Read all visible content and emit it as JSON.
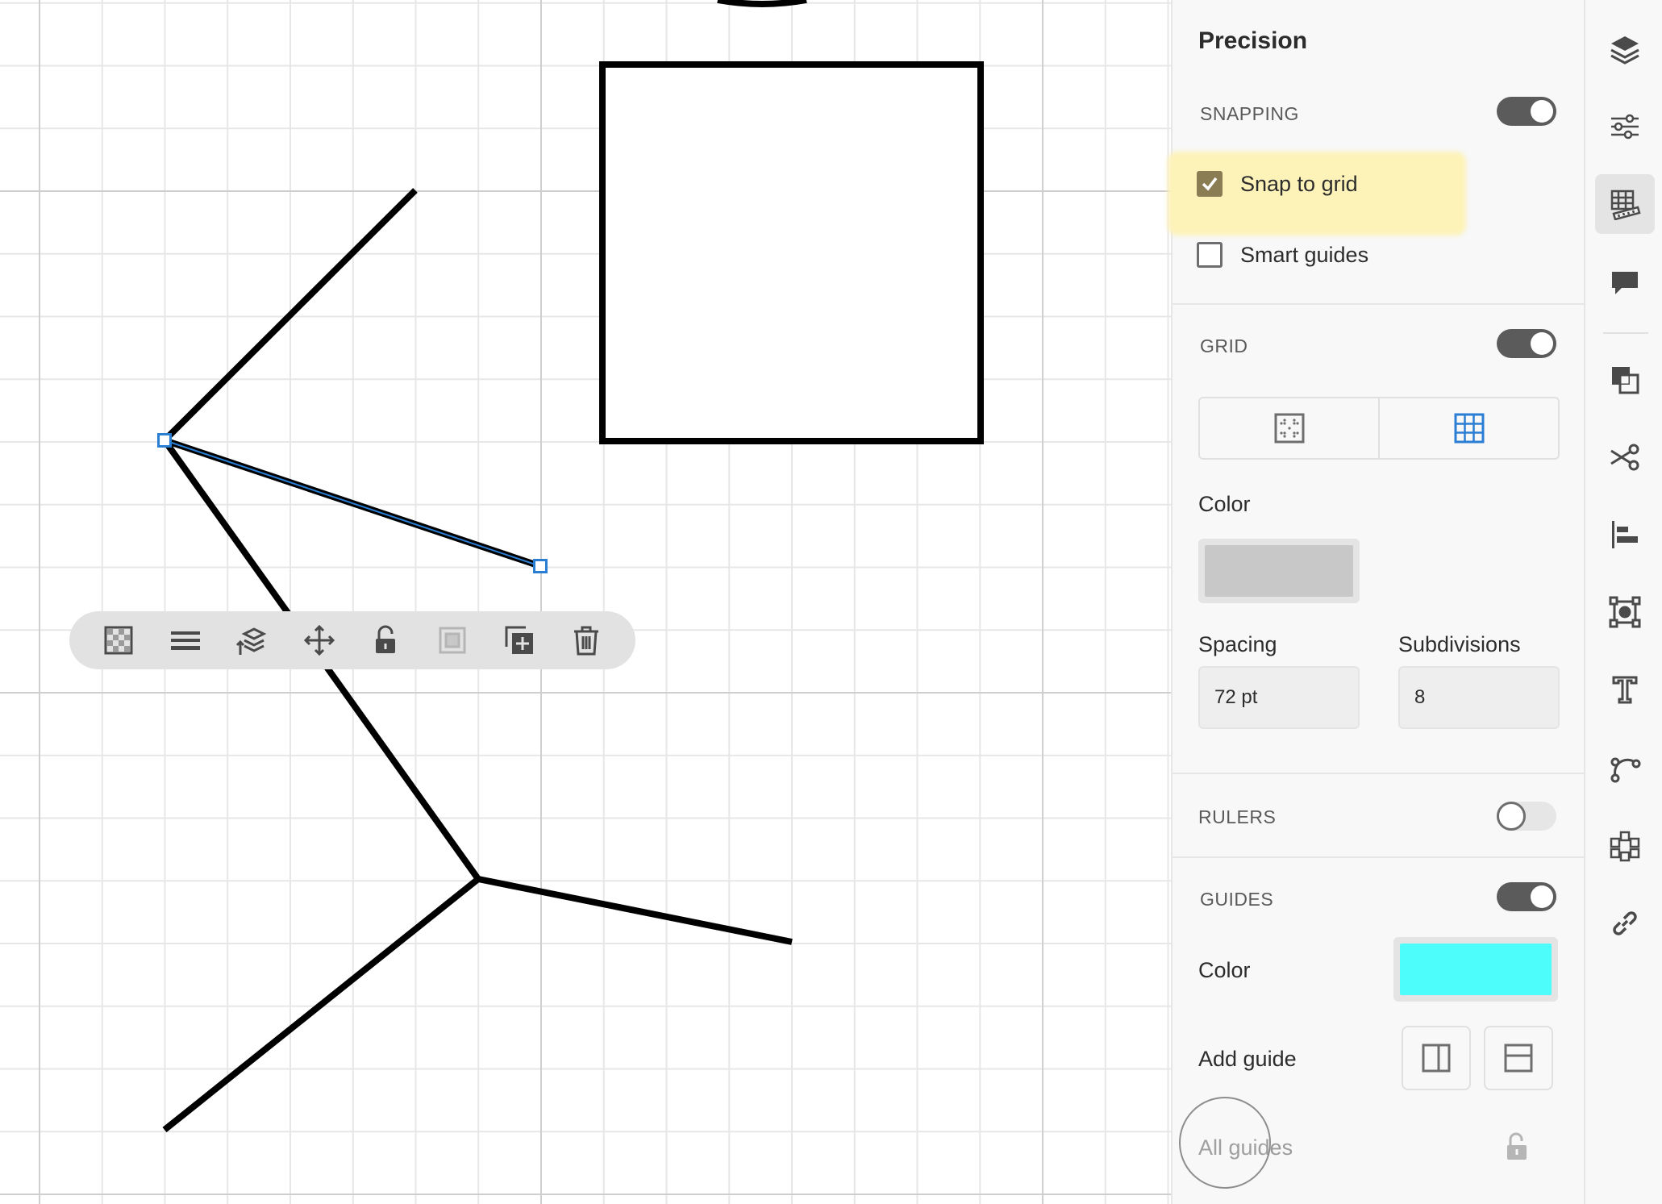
{
  "panel": {
    "title": "Precision",
    "snapping": {
      "label": "SNAPPING",
      "enabled": true,
      "snap_to_grid": {
        "label": "Snap to grid",
        "checked": true
      },
      "smart_guides": {
        "label": "Smart guides",
        "checked": false
      }
    },
    "grid": {
      "label": "GRID",
      "enabled": true,
      "styles": [
        {
          "icon": "dotted-grid-icon",
          "selected": false
        },
        {
          "icon": "line-grid-icon",
          "selected": true
        }
      ],
      "color_label": "Color",
      "color": "#c8c8c8",
      "spacing_label": "Spacing",
      "spacing_value": "72 pt",
      "subdivisions_label": "Subdivisions",
      "subdivisions_value": "8"
    },
    "rulers": {
      "label": "RULERS",
      "enabled": false
    },
    "guides": {
      "label": "GUIDES",
      "enabled": true,
      "color_label": "Color",
      "color": "#4dfdfc",
      "add_guide_label": "Add guide",
      "all_guides_label": "All guides"
    }
  },
  "toolbar": {
    "items": [
      "checkerboard-fill-icon",
      "stroke-weight-icon",
      "arrange-layers-icon",
      "move-icon",
      "lock-open-icon",
      "group-icon",
      "duplicate-icon",
      "trash-icon"
    ]
  },
  "rail": {
    "items": [
      "layers-icon",
      "properties-icon",
      "precision-icon",
      "comments-icon",
      "combine-shapes-icon",
      "cut-icon",
      "align-icon",
      "transform-icon",
      "type-icon",
      "path-icon",
      "repeat-icon",
      "link-icon"
    ],
    "active": "precision-icon"
  },
  "colors": {
    "selection": "#2a7ed3",
    "highlight": "#fdf2b8",
    "checkbox": "#8a7d54",
    "toggle_on": "#5b5b5b"
  }
}
